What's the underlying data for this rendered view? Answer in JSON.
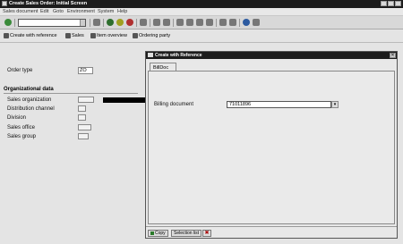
{
  "window": {
    "title": "Create Sales Order: Initial Screen"
  },
  "menu": [
    "Sales document",
    "Edit",
    "Goto",
    "Environment",
    "System",
    "Help"
  ],
  "app_toolbar": {
    "create_with_reference": "Create with reference",
    "sales": "Sales",
    "item_overview": "Item overview",
    "ordering_party": "Ordering party"
  },
  "form": {
    "order_type_label": "Order type",
    "order_type_value": "ZO",
    "org_data_header": "Organizational data",
    "sales_org_label": "Sales organization",
    "dist_channel_label": "Distribution channel",
    "division_label": "Division",
    "sales_office_label": "Sales office",
    "sales_group_label": "Sales group"
  },
  "dialog": {
    "title": "Create with Reference",
    "tab_label": "BillDoc",
    "billing_doc_label": "Billing document",
    "billing_doc_value": "71011896",
    "copy_label": "Copy",
    "selection_list_label": "Selection list"
  }
}
